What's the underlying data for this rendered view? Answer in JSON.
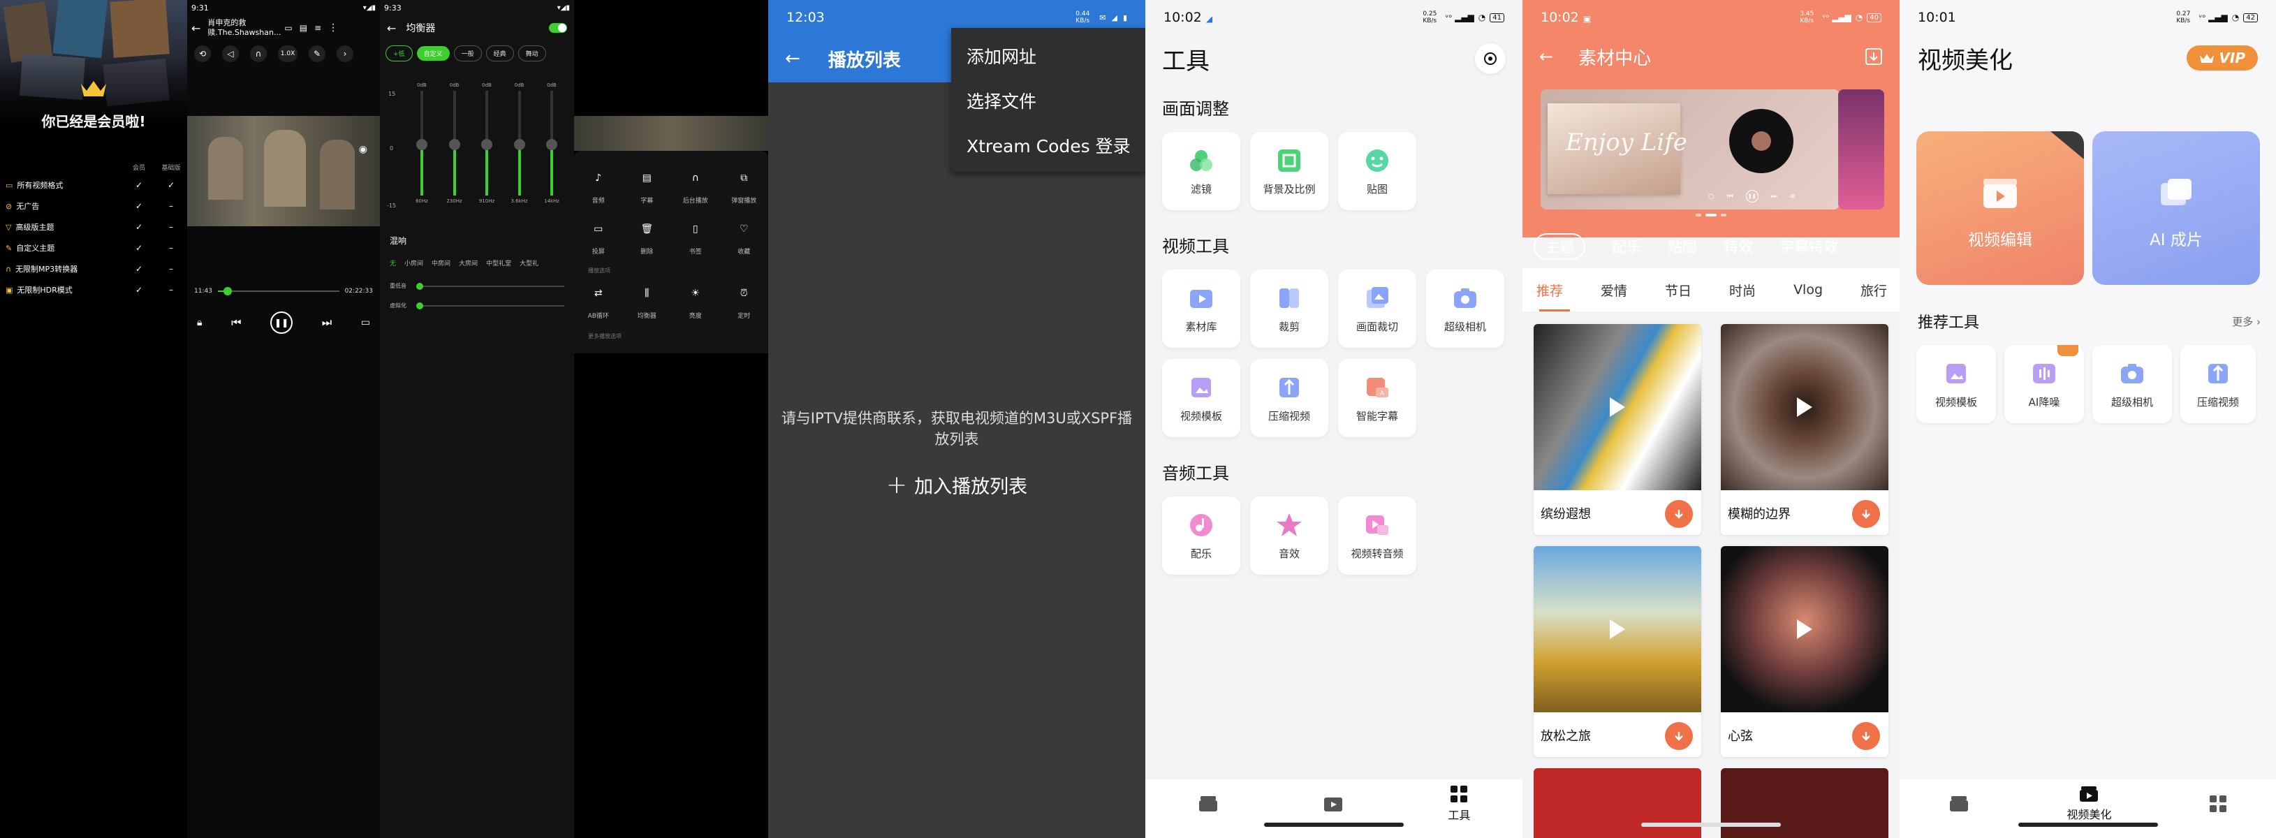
{
  "p1": {
    "crown_title": "你已经是会员啦!",
    "col_vip": "会员",
    "col_basic": "基础版",
    "rows": [
      {
        "label": "所有视频格式",
        "vip": "✓",
        "basic": "✓"
      },
      {
        "label": "无广告",
        "vip": "✓",
        "basic": "–"
      },
      {
        "label": "高级版主题",
        "vip": "✓",
        "basic": "–"
      },
      {
        "label": "自定义主题",
        "vip": "✓",
        "basic": "–"
      },
      {
        "label": "无限制MP3转换器",
        "vip": "✓",
        "basic": "–"
      },
      {
        "label": "无限制HDR模式",
        "vip": "✓",
        "basic": "–"
      }
    ],
    "player_time": "9:31",
    "player_title": "肖申克的救赎.The.Shawshan...",
    "speed": "1.0X",
    "elapsed": "11:43",
    "total": "02:22:33",
    "eq_time": "9:33",
    "eq_title": "均衡器",
    "eq_presets": [
      "+低",
      "自定义",
      "一般",
      "经典",
      "舞动"
    ],
    "eq_db_top": "15",
    "eq_db_mid": "0",
    "eq_db_bottom": "-15",
    "eq_band_values": [
      "0dB",
      "0dB",
      "0dB",
      "0dB",
      "0dB"
    ],
    "eq_freqs": [
      "60Hz",
      "230Hz",
      "910Hz",
      "3.6kHz",
      "14kHz"
    ],
    "reverb_title": "混响",
    "reverb_opts": [
      "无",
      "小房间",
      "中房间",
      "大房间",
      "中型礼堂",
      "大型礼"
    ],
    "bass_label": "重低音",
    "virt_label": "虚拟化",
    "menu_tiles": [
      [
        "音频",
        "字幕",
        "后台播放",
        "弹窗播放"
      ],
      [
        "投屏",
        "删除",
        "书签",
        "收藏"
      ],
      [
        "AB循环",
        "均衡器",
        "亮度",
        "定时"
      ]
    ],
    "menu_sub": "播放选项",
    "menu_sub2": "更多播放选项"
  },
  "p2": {
    "time": "12:03",
    "title": "播放列表",
    "menu": [
      "添加网址",
      "选择文件",
      "Xtream Codes 登录"
    ],
    "hint": "请与IPTV提供商联系，获取电视频道的M3U或XSPF播放列表",
    "add_label": "加入播放列表",
    "net": "0.44 KB/s"
  },
  "p3": {
    "time": "10:02",
    "title": "工具",
    "sections": [
      {
        "title": "画面调整",
        "items": [
          "滤镜",
          "背景及比例",
          "贴图"
        ]
      },
      {
        "title": "视频工具",
        "items": [
          "素材库",
          "裁剪",
          "画面裁切",
          "超级相机",
          "视频模板",
          "压缩视频",
          "智能字幕"
        ]
      },
      {
        "title": "音频工具",
        "items": [
          "配乐",
          "音效",
          "视频转音频"
        ]
      }
    ],
    "nav_tools": "工具",
    "net": "0.25 KB/s",
    "battery": "41"
  },
  "p4": {
    "time": "10:02",
    "title": "素材中心",
    "banner_text": "Enjoy Life",
    "tabs": [
      "主题",
      "配乐",
      "贴图",
      "特效",
      "字幕特效"
    ],
    "subtabs": [
      "推荐",
      "爱情",
      "节日",
      "时尚",
      "Vlog",
      "旅行"
    ],
    "cards": [
      "缤纷遐想",
      "模糊的边界",
      "放松之旅",
      "心弦"
    ],
    "net": "3.45 KB/s",
    "battery": "40"
  },
  "p5": {
    "time": "10:01",
    "title": "视频美化",
    "vip": "VIP",
    "big": [
      "视频编辑",
      "AI 成片"
    ],
    "rec_title": "推荐工具",
    "more": "更多",
    "rec": [
      "视频模板",
      "AI降噪",
      "超级相机",
      "压缩视频"
    ],
    "nav_center": "视频美化",
    "net": "0.27 KB/s",
    "battery": "42"
  },
  "colors": {
    "green": "#3ccf2e",
    "blue": "#2d78d7",
    "orange": "#f4876a",
    "accent": "#f07048"
  }
}
